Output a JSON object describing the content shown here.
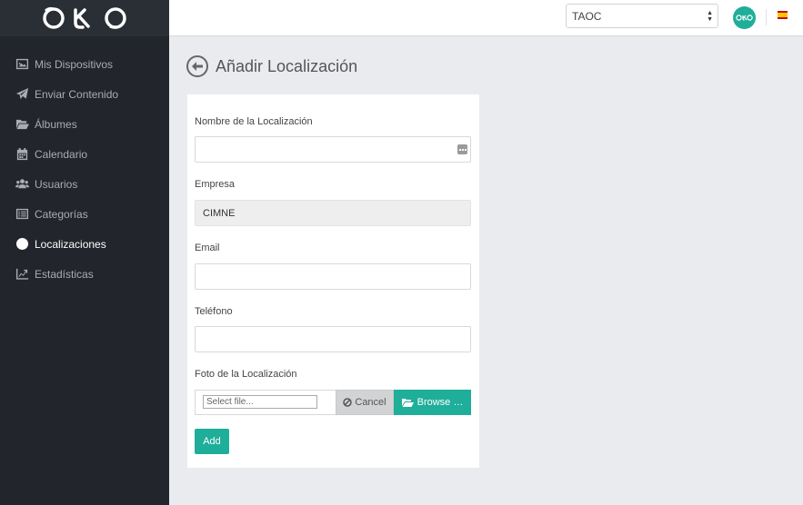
{
  "brand": {
    "logo_text": "OKO",
    "accent_color": "#1fae9a"
  },
  "sidebar": {
    "items": [
      {
        "label": "Mis Dispositivos",
        "icon": "image-icon",
        "active": false
      },
      {
        "label": "Enviar Contenido",
        "icon": "paper-plane-icon",
        "active": false
      },
      {
        "label": "Álbumes",
        "icon": "folder-open-icon",
        "active": false
      },
      {
        "label": "Calendario",
        "icon": "calendar-icon",
        "active": false
      },
      {
        "label": "Usuarios",
        "icon": "users-icon",
        "active": false
      },
      {
        "label": "Categorías",
        "icon": "list-icon",
        "active": false
      },
      {
        "label": "Localizaciones",
        "icon": "globe-icon",
        "active": true
      },
      {
        "label": "Estadísticas",
        "icon": "chart-line-icon",
        "active": false
      }
    ]
  },
  "topbar": {
    "organization_selected": "TAOC",
    "language": "es"
  },
  "page": {
    "title": "Añadir Localización"
  },
  "form": {
    "name_label": "Nombre de la Localización",
    "name_value": "",
    "company_label": "Empresa",
    "company_value": "CIMNE",
    "email_label": "Email",
    "email_value": "",
    "phone_label": "Teléfono",
    "phone_value": "",
    "photo_label": "Foto de la Localización",
    "photo_placeholder": "Select file...",
    "cancel_label": "Cancel",
    "browse_label": "Browse …",
    "submit_label": "Add"
  }
}
